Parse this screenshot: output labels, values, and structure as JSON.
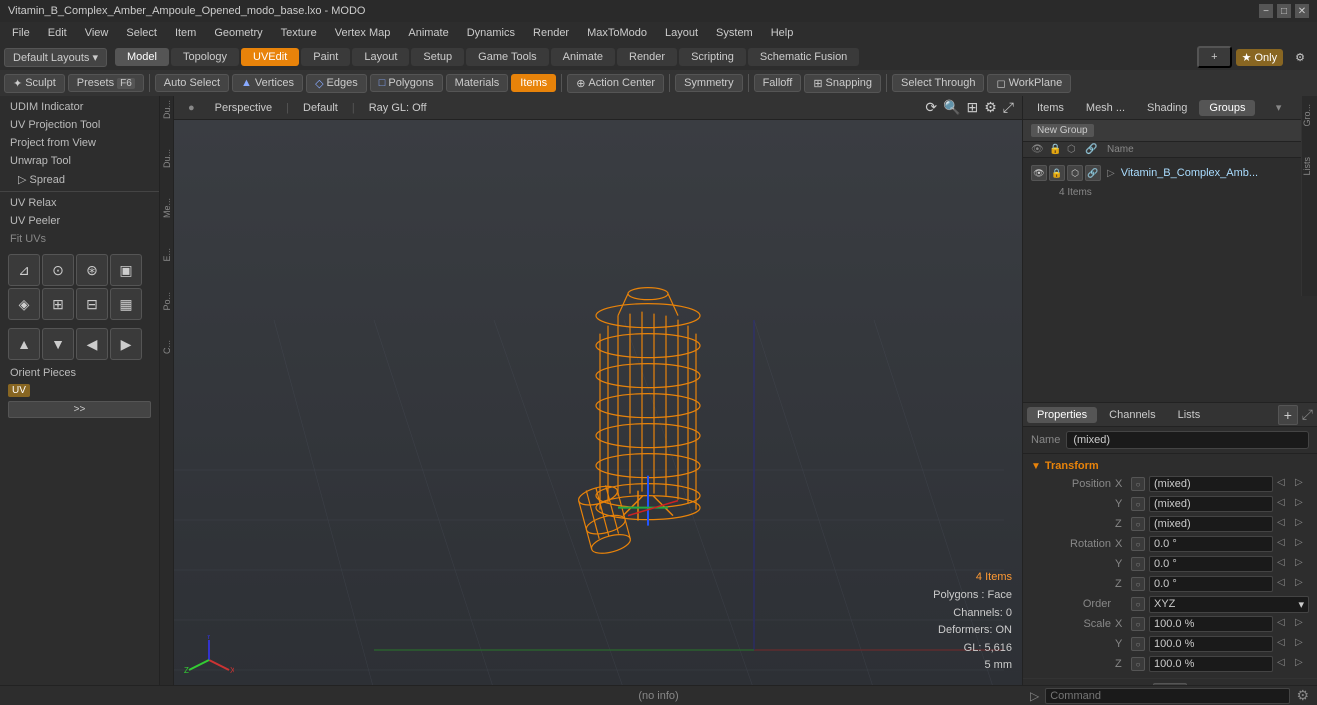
{
  "titlebar": {
    "title": "Vitamin_B_Complex_Amber_Ampoule_Opened_modo_base.lxo - MODO",
    "min_btn": "−",
    "max_btn": "□",
    "close_btn": "✕"
  },
  "menubar": {
    "items": [
      "File",
      "Edit",
      "View",
      "Select",
      "Item",
      "Geometry",
      "Texture",
      "Vertex Map",
      "Animate",
      "Dynamics",
      "Render",
      "MaxToModo",
      "Layout",
      "System",
      "Help"
    ]
  },
  "toolbar": {
    "layout_dropdown": "Default Layouts ▾",
    "tabs": [
      "Model",
      "Topology",
      "UVEdit",
      "Paint",
      "Layout",
      "Setup",
      "Game Tools",
      "Animate",
      "Render",
      "Scripting",
      "Schematic Fusion"
    ],
    "active_tab": "UVEdit",
    "add_btn": "+",
    "only_label": "Only",
    "settings_icon": "⚙"
  },
  "subtoolbar": {
    "sculpt_btn": "Sculpt",
    "presets_btn": "Presets",
    "f6_label": "F6",
    "auto_select": "Auto Select",
    "vertices": "Vertices",
    "edges": "Edges",
    "polygons": "Polygons",
    "materials": "Materials",
    "items": "Items",
    "action_center": "Action Center",
    "symmetry": "Symmetry",
    "falloff": "Falloff",
    "snapping": "Snapping",
    "select_through": "Select Through",
    "workplane": "WorkPlane"
  },
  "left_sidebar": {
    "items": [
      "UDIM Indicator",
      "UV Projection Tool",
      "Project from View",
      "Unwrap Tool",
      "Spread",
      "UV Relax",
      "UV Peeler",
      "Fit UVs",
      "Orient Pieces"
    ],
    "uv_label": "UV",
    "expand_btn": ">>"
  },
  "viewport": {
    "view_mode": "Perspective",
    "shading": "Default",
    "ray_gl": "Ray GL: Off",
    "icons": [
      "⟳",
      "🔍",
      "⊞",
      "⚙"
    ],
    "info": {
      "items_count": "4 Items",
      "polygons": "Polygons : Face",
      "channels": "Channels: 0",
      "deformers": "Deformers: ON",
      "gl": "GL: 5,616",
      "size": "5 mm"
    }
  },
  "right_panel": {
    "tabs": [
      "Items",
      "Mesh ...",
      "Shading",
      "Groups"
    ],
    "active_tab": "Groups",
    "new_group_btn": "New Group",
    "item_cols": [
      "👁",
      "🔒",
      "⬡",
      "🔗"
    ],
    "item_name": "Vitamin_B_Complex_Amb...",
    "item_sub": "4 Items"
  },
  "properties": {
    "tabs": [
      "Properties",
      "Channels",
      "Lists"
    ],
    "active_tab": "Properties",
    "add_btn": "+",
    "name_label": "Name",
    "name_value": "(mixed)",
    "transform_label": "Transform",
    "fields": [
      {
        "label": "Position",
        "axis": "X",
        "value": "(mixed)"
      },
      {
        "label": "",
        "axis": "Y",
        "value": "(mixed)"
      },
      {
        "label": "",
        "axis": "Z",
        "value": "(mixed)"
      },
      {
        "label": "Rotation",
        "axis": "X",
        "value": "0.0 °"
      },
      {
        "label": "",
        "axis": "Y",
        "value": "0.0 °"
      },
      {
        "label": "",
        "axis": "Z",
        "value": "0.0 °"
      },
      {
        "label": "Order",
        "axis": "",
        "value": "XYZ"
      },
      {
        "label": "Scale",
        "axis": "X",
        "value": "100.0 %"
      },
      {
        "label": "",
        "axis": "Y",
        "value": "100.0 %"
      },
      {
        "label": "",
        "axis": "Z",
        "value": "100.0 %"
      }
    ]
  },
  "statusbar": {
    "text": "(no info)"
  },
  "commandbar": {
    "placeholder": "Command"
  },
  "right_edge": {
    "buttons": [
      "Gro...",
      "Lists"
    ]
  },
  "vertical_labels": [
    "Du...",
    "Du...",
    "Me...",
    "E...",
    "Po...",
    "C..."
  ]
}
